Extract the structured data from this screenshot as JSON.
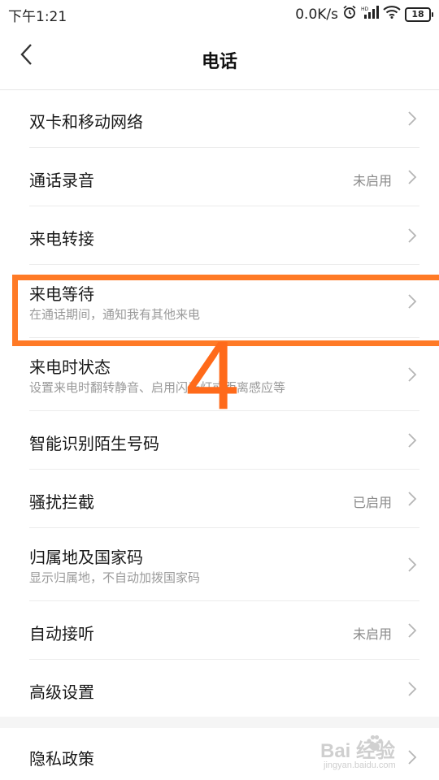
{
  "status_bar": {
    "time": "下午1:21",
    "network_speed": "0.0K/s",
    "battery": "18",
    "icons": [
      "alarm-icon",
      "hd-signal-icon",
      "wifi-icon",
      "battery-icon"
    ]
  },
  "header": {
    "title": "电话",
    "back_icon": "back-arrow-icon"
  },
  "rows": [
    {
      "title": "双卡和移动网络",
      "subtitle": "",
      "status": ""
    },
    {
      "title": "通话录音",
      "subtitle": "",
      "status": "未启用"
    },
    {
      "title": "来电转接",
      "subtitle": "",
      "status": ""
    },
    {
      "title": "来电等待",
      "subtitle": "在通话期间，通知我有其他来电",
      "status": ""
    },
    {
      "title": "来电时状态",
      "subtitle": "设置来电时翻转静音、启用闪光灯或距离感应等",
      "status": ""
    },
    {
      "title": "智能识别陌生号码",
      "subtitle": "",
      "status": ""
    },
    {
      "title": "骚扰拦截",
      "subtitle": "",
      "status": "已启用"
    },
    {
      "title": "归属地及国家码",
      "subtitle": "显示归属地，不自动加拨国家码",
      "status": ""
    },
    {
      "title": "自动接听",
      "subtitle": "",
      "status": "未启用"
    },
    {
      "title": "高级设置",
      "subtitle": "",
      "status": ""
    },
    {
      "title": "隐私政策",
      "subtitle": "",
      "status": ""
    }
  ],
  "annotation": {
    "step_number": "4",
    "highlight_color": "#ff7a26"
  },
  "watermark": {
    "text": "Bai 经验",
    "url": "jingyan.baidu.com"
  }
}
